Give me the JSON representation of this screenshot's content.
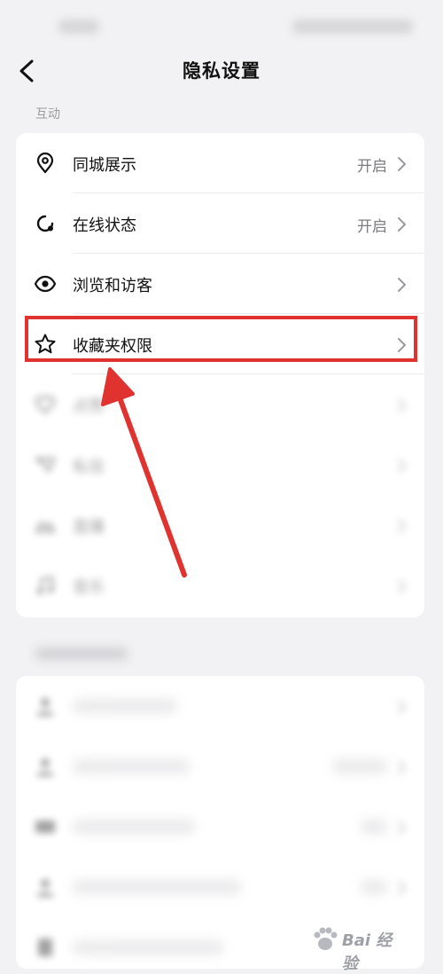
{
  "header": {
    "title": "隐私设置"
  },
  "sections": [
    {
      "label": "互动",
      "items": [
        {
          "label": "同城展示",
          "value": "开启",
          "icon": "location-pin-icon"
        },
        {
          "label": "在线状态",
          "value": "开启",
          "icon": "online-status-icon"
        },
        {
          "label": "浏览和访客",
          "value": "",
          "icon": "eye-icon"
        },
        {
          "label": "收藏夹权限",
          "value": "",
          "icon": "star-icon"
        },
        {
          "label": "点赞",
          "value": "",
          "icon": "like-icon"
        },
        {
          "label": "私信",
          "value": "",
          "icon": "message-icon"
        },
        {
          "label": "直播",
          "value": "",
          "icon": "live-icon"
        },
        {
          "label": "音乐",
          "value": "",
          "icon": "music-icon"
        }
      ]
    },
    {
      "label": "",
      "items": [
        {
          "label": "",
          "value": "",
          "icon": "user-icon"
        },
        {
          "label": "",
          "value": "",
          "icon": "user-icon"
        },
        {
          "label": "",
          "value": "",
          "icon": "card-icon"
        },
        {
          "label": "",
          "value": "",
          "icon": "user-icon"
        },
        {
          "label": "",
          "value": "",
          "icon": "document-icon"
        }
      ]
    }
  ],
  "annotation": {
    "highlight_color": "#e0322f"
  },
  "watermark": {
    "text": "Bai 经验"
  }
}
